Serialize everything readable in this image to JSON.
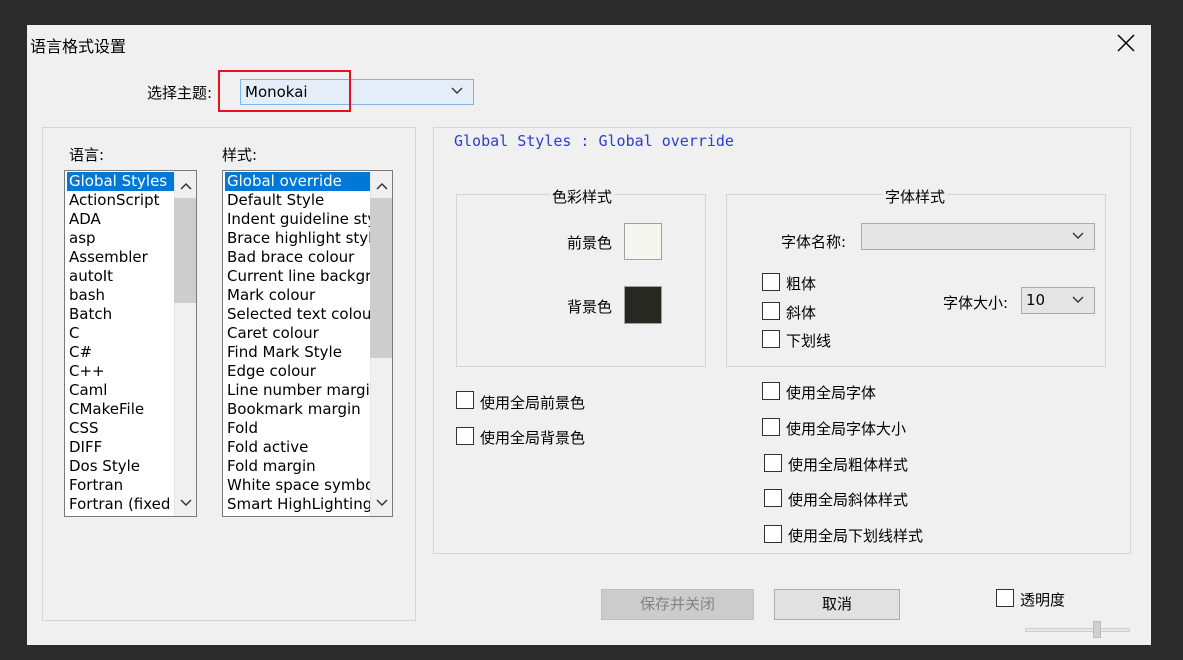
{
  "dialog": {
    "title": "语言格式设置"
  },
  "theme": {
    "label": "选择主题:",
    "value": "Monokai"
  },
  "languages": {
    "label": "语言:",
    "items": [
      "Global Styles",
      "ActionScript",
      "ADA",
      "asp",
      "Assembler",
      "autoIt",
      "bash",
      "Batch",
      "C",
      "C#",
      "C++",
      "Caml",
      "CMakeFile",
      "CSS",
      "DIFF",
      "Dos Style",
      "Fortran",
      "Fortran (fixed"
    ],
    "selected_index": 0
  },
  "styles": {
    "label": "样式:",
    "items": [
      "Global override",
      "Default Style",
      "Indent guideline sty",
      "Brace highlight style",
      "Bad brace colour",
      "Current line backgro",
      "Mark colour",
      "Selected text colour",
      "Caret colour",
      "Find Mark Style",
      "Edge colour",
      "Line number margin",
      "Bookmark margin",
      "Fold",
      "Fold active",
      "Fold margin",
      "White space symbol",
      "Smart HighLighting"
    ],
    "selected_index": 0
  },
  "style_heading": "Global Styles : Global override",
  "color_group": {
    "title": "色彩样式",
    "fg_label": "前景色",
    "bg_label": "背景色",
    "fg_color": "#f6f6f1",
    "bg_color": "#272822"
  },
  "font_group": {
    "title": "字体样式",
    "name_label": "字体名称:",
    "name_value": "",
    "size_label": "字体大小:",
    "size_value": "10",
    "bold_label": "粗体",
    "italic_label": "斜体",
    "underline_label": "下划线"
  },
  "global_options": {
    "use_global_fg": "使用全局前景色",
    "use_global_bg": "使用全局背景色",
    "use_global_font": "使用全局字体",
    "use_global_font_size": "使用全局字体大小",
    "use_global_bold": "使用全局粗体样式",
    "use_global_italic": "使用全局斜体样式",
    "use_global_underline": "使用全局下划线样式"
  },
  "buttons": {
    "save_close": "保存并关闭",
    "cancel": "取消"
  },
  "transparency": {
    "label": "透明度",
    "level": 0.7
  },
  "colors": {
    "highlight_box": "#e81123",
    "selection": "#0078d7",
    "heading_text": "#2c3bd6"
  }
}
